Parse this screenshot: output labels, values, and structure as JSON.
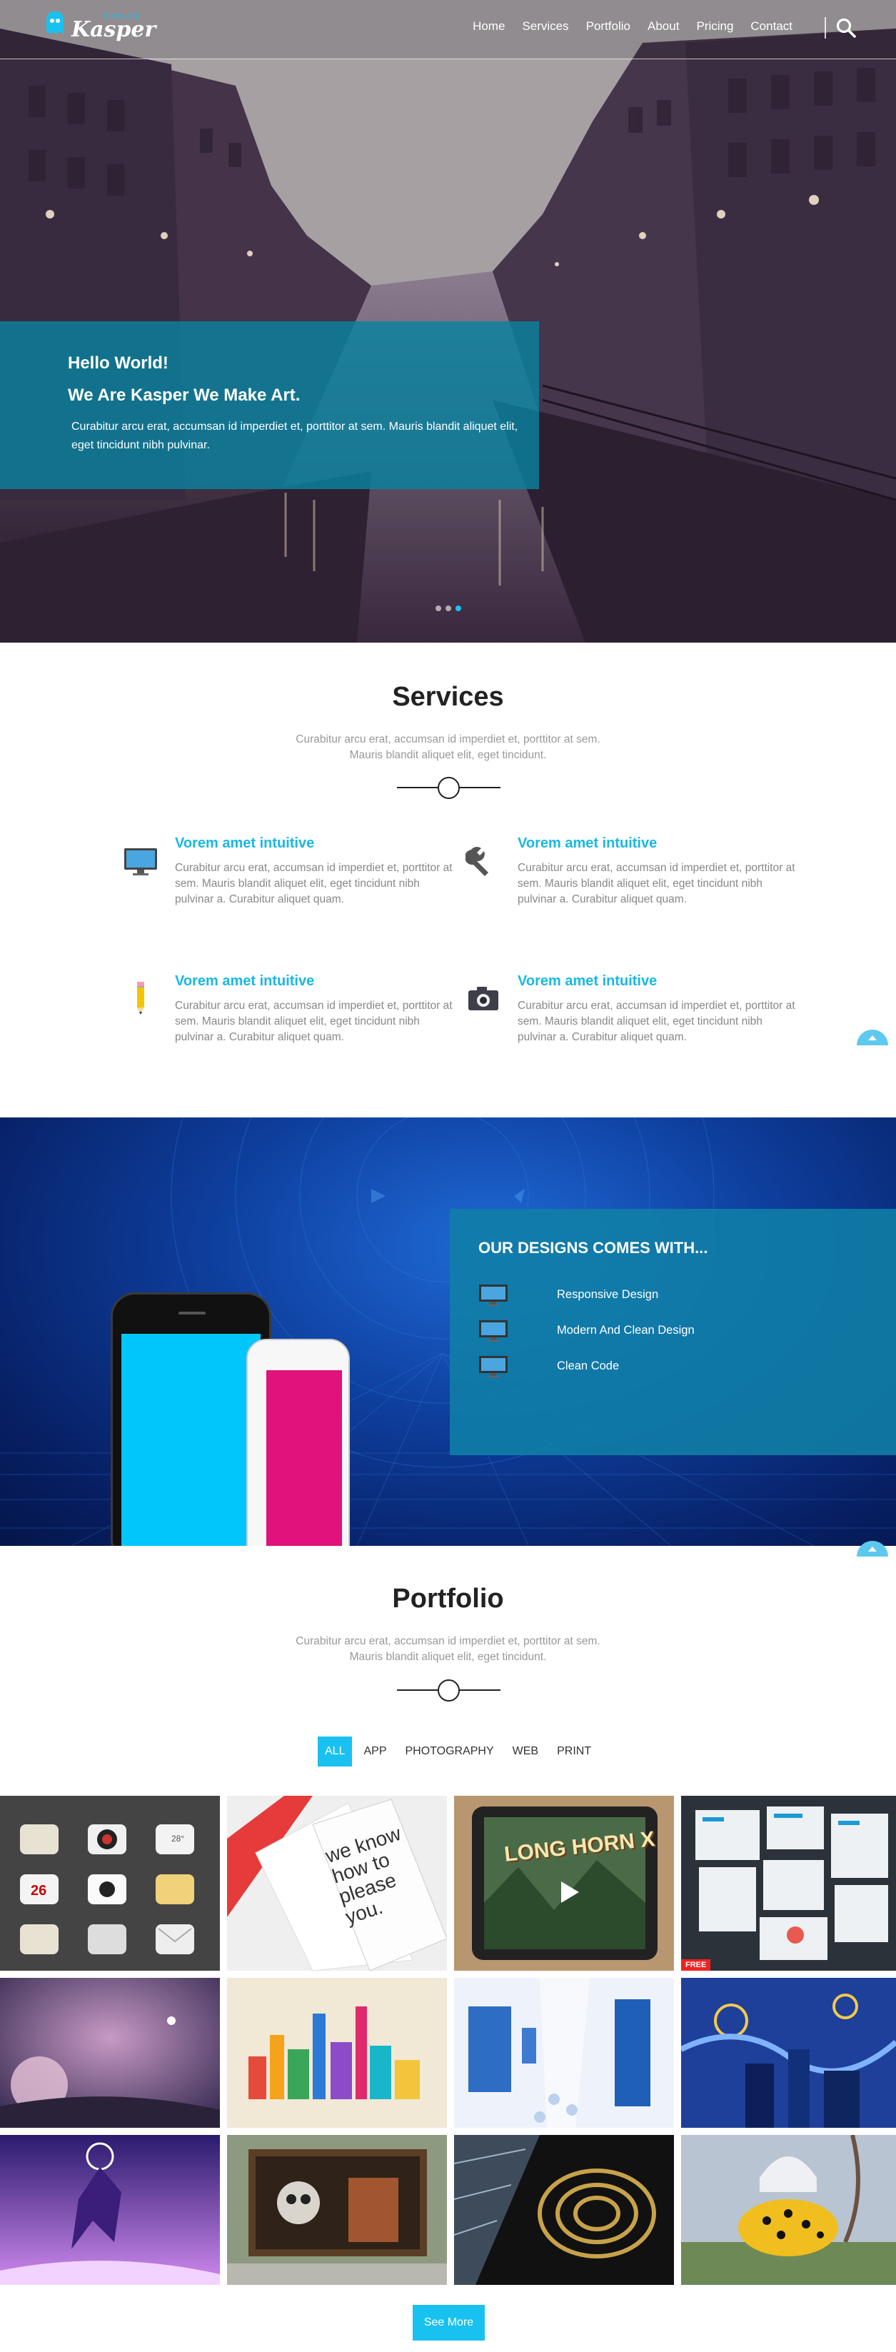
{
  "nav": {
    "logo_text": "Kasper",
    "logo_sub": "TEMPLATE",
    "links": [
      "Home",
      "Services",
      "Portfolio",
      "About",
      "Pricing",
      "Contact"
    ]
  },
  "hero": {
    "line1": "Hello World!",
    "line2": "We Are Kasper We Make Art.",
    "text": "Curabitur arcu erat, accumsan id imperdiet et, porttitor at sem. Mauris blandit aliquet elit, eget tincidunt nibh pulvinar.",
    "slide_active": 3,
    "slide_count": 3
  },
  "services": {
    "title": "Services",
    "desc": "Curabitur arcu erat, accumsan id imperdiet et, porttitor at sem. Mauris blandit aliquet elit, eget tincidunt.",
    "items": [
      {
        "icon": "monitor-icon",
        "title": "Vorem amet intuitive",
        "text": "Curabitur arcu erat, accumsan id imperdiet et, porttitor at sem. Mauris blandit aliquet elit, eget tincidunt nibh pulvinar a. Curabitur aliquet quam."
      },
      {
        "icon": "wrench-icon",
        "title": "Vorem amet intuitive",
        "text": "Curabitur arcu erat, accumsan id imperdiet et, porttitor at sem. Mauris blandit aliquet elit, eget tincidunt nibh pulvinar a. Curabitur aliquet quam."
      },
      {
        "icon": "pencil-icon",
        "title": "Vorem amet intuitive",
        "text": "Curabitur arcu erat, accumsan id imperdiet et, porttitor at sem. Mauris blandit aliquet elit, eget tincidunt nibh pulvinar a. Curabitur aliquet quam."
      },
      {
        "icon": "camera-icon",
        "title": "Vorem amet intuitive",
        "text": "Curabitur arcu erat, accumsan id imperdiet et, porttitor at sem. Mauris blandit aliquet elit, eget tincidunt nibh pulvinar a. Curabitur aliquet quam."
      }
    ]
  },
  "features": {
    "title": "OUR DESIGNS COMES WITH...",
    "items": [
      "Responsive Design",
      "Modern And Clean Design",
      "Clean Code"
    ]
  },
  "portfolio": {
    "title": "Portfolio",
    "desc": "Curabitur arcu erat, accumsan id imperdiet et, porttitor at sem. Mauris blandit aliquet elit, eget tincidunt.",
    "filters": [
      "ALL",
      "APP",
      "PHOTOGRAPHY",
      "WEB",
      "PRINT"
    ],
    "active_filter": "ALL",
    "tile_text": {
      "please": "we know how to please you.",
      "longhorn": "LONG HORN X",
      "free": "FREE",
      "date": "26",
      "temp": "28°"
    },
    "see_more": "See More"
  },
  "colors": {
    "accent": "#19c1f0",
    "service_title": "#19b8e6",
    "hero_box": "#0a82a0"
  }
}
